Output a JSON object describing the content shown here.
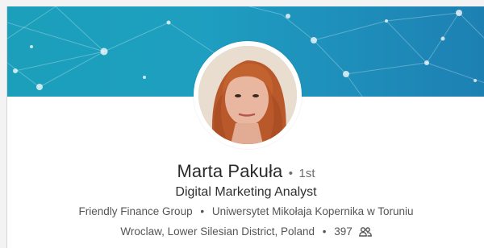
{
  "profile": {
    "name": "Marta Pakuła",
    "degree": "1st",
    "degree_separator": "•",
    "headline": "Digital Marketing Analyst",
    "company": "Friendly Finance Group",
    "education": "Uniwersytet Mikołaja Kopernika w Toruniu",
    "location": "Wroclaw, Lower Silesian District, Poland",
    "connections": "397",
    "connections_icon": "people-icon",
    "avatar_icon": "profile-photo"
  },
  "colors": {
    "banner_start": "#1b9fba",
    "banner_end": "#1d80b3",
    "text_primary": "#2b2b2b",
    "text_secondary": "#555555"
  }
}
